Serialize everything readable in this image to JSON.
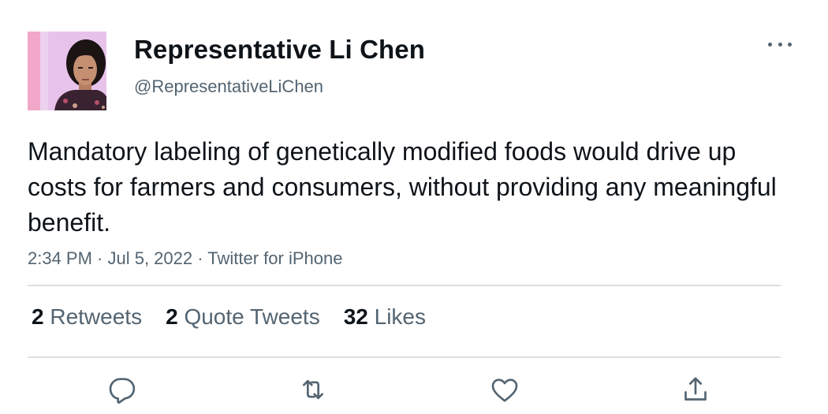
{
  "author": {
    "name": "Representative Li Chen",
    "handle": "@RepresentativeLiChen",
    "avatar_icon": "profile-photo"
  },
  "tweet": {
    "text": "Mandatory labeling of genetically modified foods would drive up costs for farmers and consumers, without providing any meaningful benefit.",
    "meta": "2:34 PM · Jul 5, 2022 · Twitter for iPhone"
  },
  "stats": {
    "retweets_count": "2",
    "retweets_label": "Retweets",
    "quote_tweets_count": "2",
    "quote_tweets_label": "Quote Tweets",
    "likes_count": "32",
    "likes_label": "Likes"
  },
  "actions": {
    "reply_icon": "reply-icon",
    "retweet_icon": "retweet-icon",
    "like_icon": "heart-icon",
    "share_icon": "share-icon"
  },
  "colors": {
    "text_primary": "#0f1419",
    "text_secondary": "#536471",
    "divider": "#dcdfe2"
  }
}
